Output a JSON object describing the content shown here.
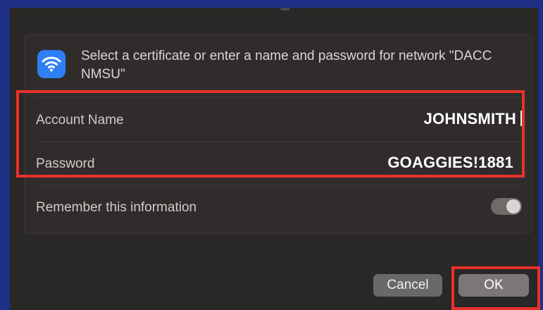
{
  "dialog": {
    "prompt": "Select a certificate or enter a name and password for network \"DACC NMSU\"",
    "icon": "wifi-icon",
    "accent_color": "#2f7ff5"
  },
  "fields": {
    "account_name_label": "Account Name",
    "account_name_value": "JOHNSMITH",
    "password_label": "Password",
    "password_value": "GOAGGIES!1881"
  },
  "remember": {
    "label": "Remember this information",
    "enabled": true
  },
  "buttons": {
    "cancel": "Cancel",
    "ok": "OK"
  },
  "annotation_color": "#e8312d"
}
